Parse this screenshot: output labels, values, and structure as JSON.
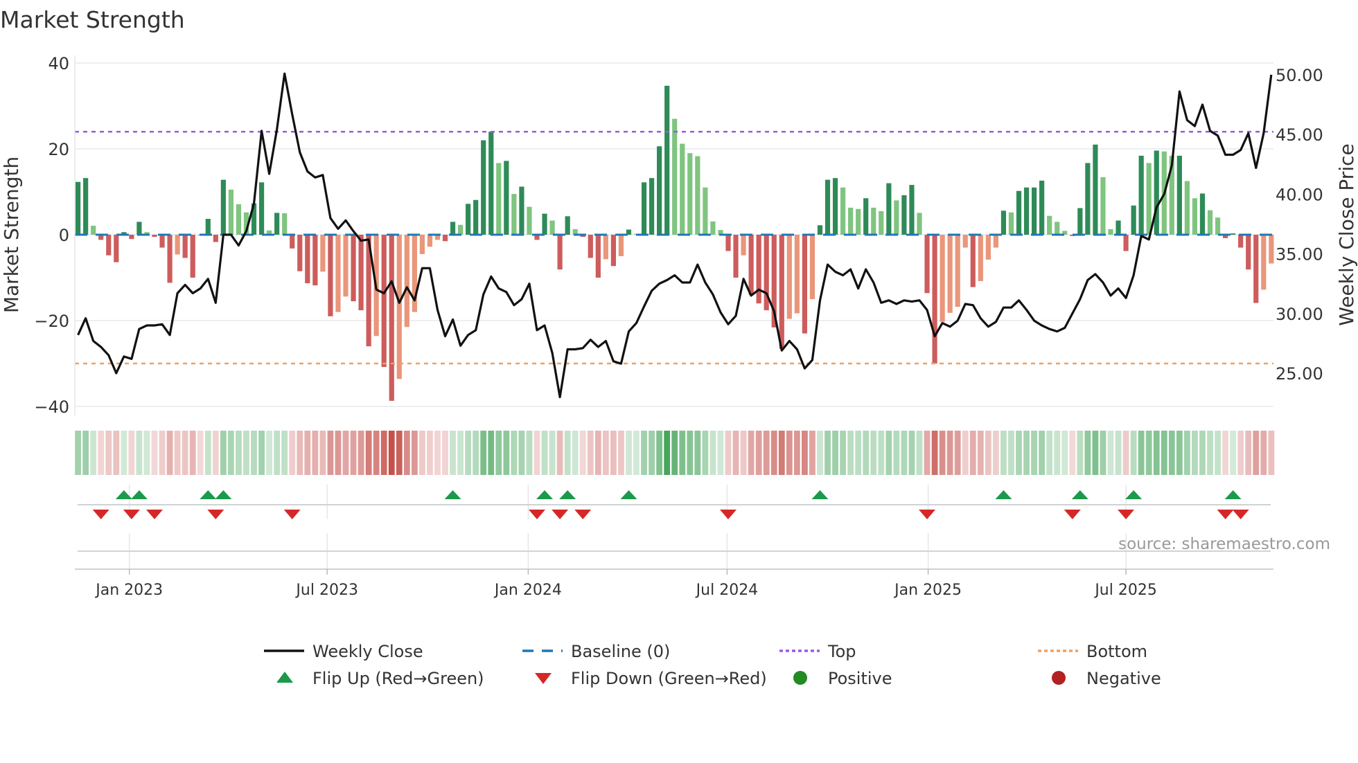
{
  "chart_data": {
    "type": "bar",
    "title": "Market Strength",
    "ylabel": "Market Strength",
    "y2label": "Weekly Close Price",
    "ylim": [
      -42,
      42
    ],
    "y2lim": [
      21.5,
      50.5
    ],
    "yticks": [
      40,
      20,
      0,
      -20,
      -40
    ],
    "yticklabels": [
      "40",
      "20",
      "0",
      "−20",
      "−40"
    ],
    "y2ticks": [
      50,
      45,
      40,
      35,
      30,
      25
    ],
    "y2ticklabels": [
      "50.00",
      "45.00",
      "40.00",
      "35.00",
      "30.00",
      "25.00"
    ],
    "start_date": "2022-11-15",
    "frequency": "weekly",
    "xticks": [
      {
        "date": "2023-01-01",
        "label": "Jan 2023"
      },
      {
        "date": "2023-07-01",
        "label": "Jul 2023"
      },
      {
        "date": "2024-01-01",
        "label": "Jan 2024"
      },
      {
        "date": "2024-07-01",
        "label": "Jul 2024"
      },
      {
        "date": "2025-01-01",
        "label": "Jan 2025"
      },
      {
        "date": "2025-07-01",
        "label": "Jul 2025"
      }
    ],
    "top_level": 24,
    "bottom_level": -30,
    "baseline": 0,
    "strength": [
      12.3,
      13.2,
      2.1,
      -1.2,
      -4.8,
      -6.4,
      0.6,
      -1.0,
      3.0,
      0.6,
      -0.5,
      -3.0,
      -11.2,
      -4.6,
      -5.4,
      -10,
      -0.2,
      3.7,
      -1.7,
      12.8,
      10.5,
      7.1,
      5.2,
      7.3,
      12.2,
      1.0,
      5.1,
      5.0,
      -3.2,
      -8.5,
      -11.3,
      -11.8,
      -8.6,
      -19,
      -18,
      -14.4,
      -15.5,
      -17.6,
      -26,
      -23.6,
      -30.8,
      -38.7,
      -33.6,
      -21.5,
      -18,
      -4.5,
      -2.8,
      -1.2,
      -1.5,
      3.0,
      2.3,
      7.2,
      8.1,
      22,
      24,
      16.7,
      17.2,
      9.5,
      11.2,
      6.5,
      -1.2,
      4.9,
      3.3,
      -8.1,
      4.3,
      1.3,
      -0.5,
      -5.4,
      -10,
      -5.7,
      -7.3,
      -5.0,
      1.2,
      0.2,
      12.2,
      13.2,
      20.6,
      34.7,
      27,
      21.2,
      19,
      18.3,
      11,
      3.1,
      1.1,
      -3.8,
      -10,
      -4.8,
      -14,
      -16,
      -17.6,
      -21.6,
      -26.6,
      -19.6,
      -18.3,
      -23,
      -15,
      2.2,
      12.8,
      13.2,
      11,
      6.3,
      6,
      8.5,
      6.3,
      5.5,
      12,
      8,
      9.2,
      11.6,
      5.1,
      -13.6,
      -30,
      -20.3,
      -18.2,
      -16.8,
      -3.0,
      -12.2,
      -10.8,
      -5.8,
      -3.0,
      5.6,
      5.2,
      10.2,
      11,
      11,
      12.6,
      4.4,
      3,
      0.9,
      -0.3,
      6.2,
      16.7,
      21,
      13.4,
      1.3,
      3.3,
      -3.8,
      6.8,
      18.4,
      16.7,
      19.6,
      19.4,
      18.4,
      18.4,
      12.5,
      8.5,
      9.6,
      5.7,
      4.0,
      -0.8,
      0.3,
      -3.0,
      -8.1,
      -15.9,
      -12.8,
      -6.7
    ],
    "weekly_close": [
      28.2,
      29.6,
      27.7,
      27.2,
      26.5,
      25.0,
      26.4,
      26.2,
      28.7,
      29.0,
      29.0,
      29.1,
      28.2,
      31.7,
      32.4,
      31.7,
      32.1,
      32.9,
      30.9,
      36.6,
      36.6,
      35.7,
      36.9,
      39.2,
      45.3,
      41.7,
      45.4,
      50.1,
      46.7,
      43.5,
      41.9,
      41.4,
      41.6,
      38.0,
      37.1,
      37.8,
      36.9,
      36.1,
      36.2,
      32.0,
      31.7,
      32.7,
      30.9,
      32.2,
      31.1,
      33.8,
      33.8,
      30.3,
      28.1,
      29.5,
      27.3,
      28.2,
      28.6,
      31.6,
      33.1,
      32.1,
      31.8,
      30.7,
      31.2,
      32.5,
      28.6,
      29.0,
      26.7,
      23.0,
      27.0,
      27.0,
      27.1,
      27.8,
      27.2,
      27.7,
      26.0,
      25.8,
      28.5,
      29.2,
      30.6,
      31.9,
      32.5,
      32.8,
      33.2,
      32.6,
      32.6,
      34.1,
      32.6,
      31.6,
      30.1,
      29.1,
      29.8,
      32.9,
      31.5,
      32.0,
      31.7,
      30.2,
      26.9,
      27.7,
      27.0,
      25.4,
      26.1,
      31.1,
      34.1,
      33.5,
      33.2,
      33.7,
      32.1,
      33.7,
      32.6,
      30.9,
      31.1,
      30.8,
      31.1,
      31.0,
      31.1,
      30.3,
      28.1,
      29.2,
      28.9,
      29.4,
      30.8,
      30.7,
      29.6,
      28.9,
      29.3,
      30.5,
      30.5,
      31.1,
      30.3,
      29.4,
      29.0,
      28.7,
      28.5,
      28.8,
      30.0,
      31.2,
      32.8,
      33.3,
      32.6,
      31.5,
      32.1,
      31.3,
      33.2,
      36.5,
      36.2,
      38.9,
      40.0,
      42.4,
      48.6,
      46.2,
      45.7,
      47.5,
      45.3,
      44.9,
      43.3,
      43.3,
      43.7,
      45.1,
      42.2,
      45.1,
      50.0
    ],
    "flip_up_indices": [
      6,
      8,
      17,
      19,
      49,
      61,
      64,
      72,
      97,
      121,
      131,
      138,
      151
    ],
    "flip_down_indices": [
      3,
      7,
      10,
      18,
      28,
      60,
      63,
      66,
      85,
      111,
      130,
      137,
      150,
      152
    ],
    "legend": {
      "placement": "bottom",
      "items": [
        {
          "label": "Weekly Close",
          "kind": "line-solid",
          "color": "#111111"
        },
        {
          "label": "Baseline (0)",
          "kind": "line-dashed",
          "color": "#1f77b4"
        },
        {
          "label": "Top",
          "kind": "line-dotted",
          "color": "#9b59e0"
        },
        {
          "label": "Bottom",
          "kind": "line-dotted",
          "color": "#f0a060"
        },
        {
          "label": "Flip Up (Red→Green)",
          "kind": "triangle-up",
          "color": "#1a9a4a"
        },
        {
          "label": "Flip Down (Green→Red)",
          "kind": "triangle-down",
          "color": "#d62728"
        },
        {
          "label": "Positive",
          "kind": "dot",
          "color": "#228b22"
        },
        {
          "label": "Negative",
          "kind": "dot",
          "color": "#b22222"
        }
      ]
    },
    "colors": {
      "pos_strong": "#2e8b57",
      "pos_weak": "#7fc47f",
      "neg_strong": "#cd5c5c",
      "neg_weak": "#e9967a",
      "heat_pos": "#3a9e50",
      "heat_neg": "#c4514c"
    },
    "annotation": "source: sharemaestro.com"
  }
}
